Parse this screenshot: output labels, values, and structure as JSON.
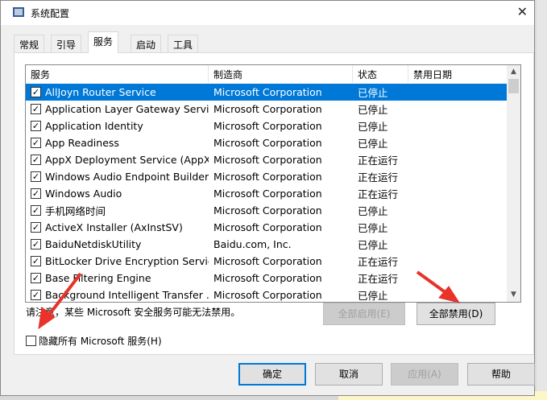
{
  "window": {
    "title": "系统配置",
    "close": "✕"
  },
  "tabs": [
    {
      "label": "常规"
    },
    {
      "label": "引导"
    },
    {
      "label": "服务"
    },
    {
      "label": "启动"
    },
    {
      "label": "工具"
    }
  ],
  "list": {
    "columns": [
      "服务",
      "制造商",
      "状态",
      "禁用日期"
    ],
    "rows": [
      {
        "name": "AllJoyn Router Service",
        "vendor": "Microsoft Corporation",
        "status": "已停止",
        "checked": true
      },
      {
        "name": "Application Layer Gateway Service",
        "vendor": "Microsoft Corporation",
        "status": "已停止",
        "checked": true
      },
      {
        "name": "Application Identity",
        "vendor": "Microsoft Corporation",
        "status": "已停止",
        "checked": true
      },
      {
        "name": "App Readiness",
        "vendor": "Microsoft Corporation",
        "status": "已停止",
        "checked": true
      },
      {
        "name": "AppX Deployment Service (AppX...",
        "vendor": "Microsoft Corporation",
        "status": "正在运行",
        "checked": true
      },
      {
        "name": "Windows Audio Endpoint Builder",
        "vendor": "Microsoft Corporation",
        "status": "正在运行",
        "checked": true
      },
      {
        "name": "Windows Audio",
        "vendor": "Microsoft Corporation",
        "status": "正在运行",
        "checked": true
      },
      {
        "name": "手机网络时间",
        "vendor": "Microsoft Corporation",
        "status": "已停止",
        "checked": true
      },
      {
        "name": "ActiveX Installer (AxInstSV)",
        "vendor": "Microsoft Corporation",
        "status": "已停止",
        "checked": true
      },
      {
        "name": "BaiduNetdiskUtility",
        "vendor": "Baidu.com, Inc.",
        "status": "已停止",
        "checked": true
      },
      {
        "name": "BitLocker Drive Encryption Service",
        "vendor": "Microsoft Corporation",
        "status": "正在运行",
        "checked": true
      },
      {
        "name": "Base Filtering Engine",
        "vendor": "Microsoft Corporation",
        "status": "正在运行",
        "checked": true
      },
      {
        "name": "Background Intelligent Transfer ...",
        "vendor": "Microsoft Corporation",
        "status": "已停止",
        "checked": true
      }
    ]
  },
  "note": "请注意，某些 Microsoft 安全服务可能无法禁用。",
  "enable_all": "全部启用(E)",
  "disable_all": "全部禁用(D)",
  "hide_ms": "隐藏所有 Microsoft 服务(H)",
  "buttons": {
    "ok": "确定",
    "cancel": "取消",
    "apply": "应用(A)",
    "help": "帮助"
  },
  "colors": {
    "selection": "#0078d7",
    "annotation": "#e8322a"
  }
}
